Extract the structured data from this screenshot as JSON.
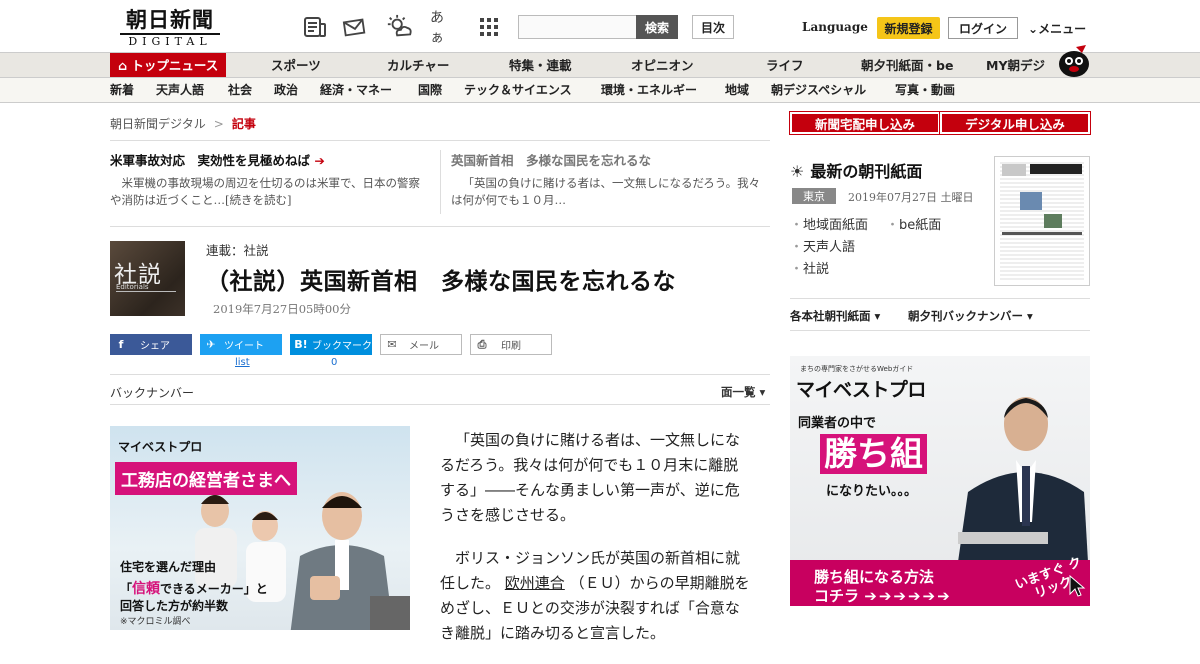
{
  "header": {
    "logo_kanji": "朝日新聞",
    "logo_sub": "DIGITAL",
    "icons": [
      "newspaper-icon",
      "mail-icon",
      "weather-icon",
      "font-size-icon",
      "grid-menu-icon"
    ],
    "font_icon_label": "あぁ",
    "search_placeholder": "",
    "search_button": "検索",
    "contents_button": "目次",
    "language": "Language",
    "register": "新規登録",
    "login": "ログイン",
    "menu": "メニュー"
  },
  "nav1": {
    "active": "トップニュース",
    "items": [
      "スポーツ",
      "カルチャー",
      "特集・連載",
      "オピニオン",
      "ライフ",
      "朝夕刊紙面・be",
      "MY朝デジ"
    ]
  },
  "nav2": {
    "items": [
      "新着",
      "天声人語",
      "社会",
      "政治",
      "経済・マネー",
      "国際",
      "テック＆サイエンス",
      "環境・エネルギー",
      "地域",
      "朝デジスペシャル",
      "写真・動画"
    ]
  },
  "breadcrumb": {
    "home": "朝日新聞デジタル",
    "sep": ">",
    "current": "記事"
  },
  "related": [
    {
      "title": "米軍事故対応　実効性を見極めねば",
      "arrow": "➔",
      "summary": "米軍機の事故現場の周辺を仕切るのは米軍で、日本の警察や消防は近づくこと…[続きを読む]"
    },
    {
      "title": "英国新首相　多様な国民を忘れるな",
      "summary": "「英国の負けに賭ける者は、一文無しになるだろう。我々は何が何でも１０月…"
    }
  ],
  "article": {
    "logo_kanji": "社説",
    "logo_en": "Editorials",
    "series": "連載：社説",
    "title": "（社説）英国新首相　多様な国民を忘れるな",
    "date": "2019年7月27日05時00分",
    "share": {
      "facebook": "シェア",
      "twitter": "ツイート",
      "hatena": "ブックマーク",
      "hatena_icon": "B!",
      "mail": "メール",
      "print": "印刷",
      "twitter_count": "list",
      "hatena_count": "0"
    },
    "back_numbers": "バックナンバー",
    "page_list": "面一覧",
    "body": [
      "「英国の負けに賭ける者は、一文無しになるだろう。我々は何が何でも１０月末に離脱する」――そんな勇ましい第一声が、逆に危うさを感じさせる。",
      "ボリス・ジョンソン氏が英国の新首相に就任した。",
      "欧州連合",
      "（ＥＵ）からの早期離脱をめざし、ＥＵとの交渉が決裂すれば「合意なき離脱」に踏み切ると宣言した。"
    ]
  },
  "ad_left": {
    "brand": "マイベストプロ",
    "headline": "工務店の経営者さまへ",
    "line1": "住宅を選んだ理由",
    "line2_pre": "「",
    "line2_hl": "信頼",
    "line2_post": "できるメーカー」と",
    "line3": "回答した方が約半数",
    "note": "※マクロミル調べ"
  },
  "sidebar": {
    "btn_delivery": "新聞宅配申し込み",
    "btn_digital": "デジタル申し込み",
    "paper_heading": "最新の朝刊紙面",
    "region": "東京",
    "paper_date": "2019年07月27日 土曜日",
    "links": [
      "地域面紙面",
      "be紙面",
      "天声人語",
      "社説"
    ],
    "dropdown1": "各本社朝刊紙面",
    "dropdown2": "朝夕刊バックナンバー"
  },
  "ad_right": {
    "tiny": "まちの専門家をさがせるWebガイド",
    "brand": "マイベストプロ",
    "peer": "同業者の中で",
    "win": "勝ち組",
    "want": "になりたい。。。",
    "band1": "勝ち組になる方法",
    "band2": "コチラ",
    "band2_arrows": "➔➔➔➔➔➔",
    "band3": "いますぐ クリック"
  },
  "colors": {
    "brand_red": "#c4000d",
    "accent_pink": "#d6127a",
    "register_yellow": "#f5c518"
  }
}
